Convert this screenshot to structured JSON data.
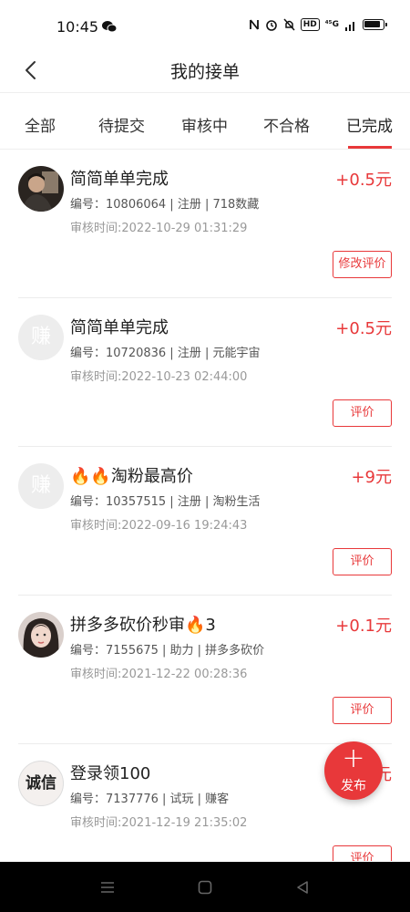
{
  "status": {
    "time": "10:45",
    "net": "⁴⁵G"
  },
  "header": {
    "title": "我的接单"
  },
  "tabs": [
    {
      "label": "全部"
    },
    {
      "label": "待提交"
    },
    {
      "label": "审核中"
    },
    {
      "label": "不合格"
    },
    {
      "label": "已完成"
    }
  ],
  "orders": [
    {
      "title": "简简单单完成",
      "reward": "+0.5元",
      "meta": "编号：10806064 | 注册 | 718数藏",
      "time": "审核时间:2022-10-29 01:31:29",
      "button": "修改评价"
    },
    {
      "title": "简简单单完成",
      "reward": "+0.5元",
      "meta": "编号：10720836 | 注册 | 元能宇宙",
      "time": "审核时间:2022-10-23 02:44:00",
      "button": "评价",
      "avatar_text": "赚"
    },
    {
      "title": "🔥🔥淘粉最高价",
      "reward": "+9元",
      "meta": "编号：10357515 | 注册 | 淘粉生活",
      "time": "审核时间:2022-09-16 19:24:43",
      "button": "评价",
      "avatar_text": "赚"
    },
    {
      "title": "拼多多砍价秒审🔥3",
      "reward": "+0.1元",
      "meta": "编号：7155675 | 助力 | 拼多多砍价",
      "time": "审核时间:2021-12-22 00:28:36",
      "button": "评价"
    },
    {
      "title": "登录领100",
      "reward": "元",
      "meta": "编号：7137776 | 试玩 | 赚客",
      "time": "审核时间:2021-12-19 21:35:02",
      "button": "评价",
      "avatar_text": "诚信"
    }
  ],
  "fab": {
    "label": "发布"
  },
  "colors": {
    "accent": "#e8383a"
  }
}
